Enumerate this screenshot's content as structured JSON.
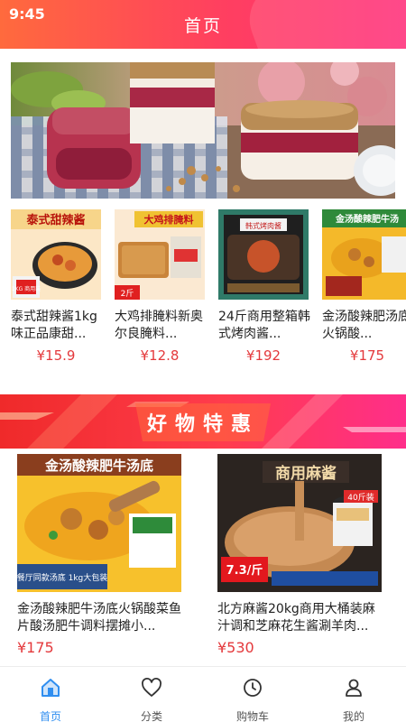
{
  "status_bar": {
    "time": "9:45"
  },
  "header": {
    "title": "首页"
  },
  "strip": [
    {
      "name": "泰式甜辣酱1kg味正品康甜...",
      "price": "¥15.9"
    },
    {
      "name": "大鸡排腌料新奥尔良腌料...",
      "price": "¥12.8"
    },
    {
      "name": "24斤商用整箱韩式烤肉酱...",
      "price": "¥192"
    },
    {
      "name": "金汤酸辣肥汤底火锅酸...",
      "price": "¥175"
    }
  ],
  "strip_image_text": {
    "thumb1_title": "泰式甜辣酱",
    "thumb1_badge": "1KG 商用装",
    "thumb2_title": "大鸡排腌料",
    "thumb2_badge": "2斤",
    "thumb3_title": "韩式烤肉酱",
    "thumb4_title": "金汤酸辣肥牛汤"
  },
  "promo": {
    "title": "好物特惠"
  },
  "featured": [
    {
      "name": "金汤酸辣肥牛汤底火锅酸菜鱼片酸汤肥牛调料摆摊小...",
      "price": "¥175"
    },
    {
      "name": "北方麻酱20kg商用大桶装麻汁调和芝麻花生酱涮羊肉...",
      "price": "¥530"
    }
  ],
  "featured_image_text": {
    "f1_title": "金汤酸辣肥牛汤底",
    "f1_sub": "餐厅同款汤底 1kg大包装",
    "f2_title": "商用麻酱",
    "f2_badge": "40斤装",
    "f2_price": "7.3/斤"
  },
  "tabbar": [
    {
      "label": "首页",
      "icon": "home-icon",
      "active": true
    },
    {
      "label": "分类",
      "icon": "heart-icon",
      "active": false
    },
    {
      "label": "购物车",
      "icon": "clock-icon",
      "active": false
    },
    {
      "label": "我的",
      "icon": "user-icon",
      "active": false
    }
  ],
  "colors": {
    "accent": "#ff3f60",
    "price": "#e4393c",
    "tab_active": "#2f8ef0"
  }
}
